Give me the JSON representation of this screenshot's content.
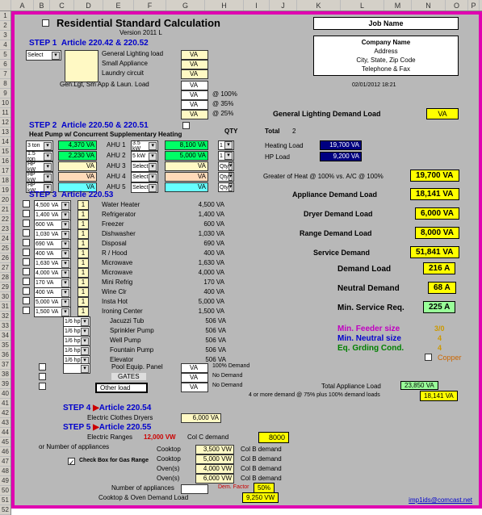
{
  "cols": [
    "A",
    "B",
    "C",
    "D",
    "E",
    "F",
    "G",
    "H",
    "I",
    "J",
    "K",
    "L",
    "M",
    "N",
    "O",
    "P"
  ],
  "title": "Residential Standard Calculation",
  "version": "Version 2011 L",
  "job_name": "Job Name",
  "company": {
    "name": "Company Name",
    "addr": "Address",
    "csz": "City, State, Zip Code",
    "tel": "Telephone & Fax"
  },
  "timestamp": "02/01/2012 18:21",
  "step1": {
    "heading": "STEP 1",
    "article": "Article 220.42 & 220.52",
    "select": "Select",
    "items": [
      "General Lighting load",
      "Small Appliance",
      "Laundry circuit"
    ],
    "sumline": "Gen.Lgt, Sm App & Laun. Load",
    "pct": [
      "@ 100%",
      "@ 35%",
      "@ 25%"
    ]
  },
  "step2": {
    "heading": "STEP 2",
    "article": "Article 220.50 & 220.51",
    "sub": "Heat Pump w/ Concurrent Supplementary Heating",
    "qty": "QTY",
    "rows": [
      {
        "sel": "3 ton",
        "v": "4,370 VA",
        "ahu": "AHU 1",
        "kw": "3.5 kW",
        "big": "8,100 VA",
        "q": "1",
        "cls": "green-box"
      },
      {
        "sel": "1.5 ton",
        "v": "2,230 VA",
        "ahu": "AHU 2",
        "kw": "5 kW",
        "big": "5,000 VA",
        "q": "1",
        "cls": "green-box"
      },
      {
        "sel": "HP kW",
        "v": "VA",
        "ahu": "AHU 3",
        "kw": "Select",
        "big": "VA",
        "q": "Qty",
        "cls": "cream-box"
      },
      {
        "sel": "HP kW",
        "v": "VA",
        "ahu": "AHU 4",
        "kw": "Select",
        "big": "VA",
        "q": "Qty",
        "cls": "peach-box"
      },
      {
        "sel": "HP kW",
        "v": "VA",
        "ahu": "AHU 5",
        "kw": "Select",
        "big": "VA",
        "q": "Qty",
        "cls": "cyan-box"
      }
    ]
  },
  "total_label": "Total",
  "total_n": "2",
  "heating_load_l": "Heating Load",
  "heating_load_v": "19,700 VA",
  "hp_load_l": "HP Load",
  "hp_load_v": "9,200 VA",
  "greater": "Greater of Heat @ 100% vs. A/C @ 100%",
  "greater_v": "19,700 VA",
  "gl_demand_l": "General Lighting Demand Load",
  "gl_demand_v": "VA",
  "step3": {
    "heading": "STEP 3",
    "article": "Article 220.53",
    "appliances": [
      {
        "sel": "4,500 VA",
        "q": "1",
        "n": "Water Heater",
        "v": "4,500 VA"
      },
      {
        "sel": "1,400 VA",
        "q": "1",
        "n": "Refrigerator",
        "v": "1,400 VA"
      },
      {
        "sel": "600 VA",
        "q": "1",
        "n": "Freezer",
        "v": "600 VA"
      },
      {
        "sel": "1,030 VA",
        "q": "1",
        "n": "Dishwasher",
        "v": "1,030 VA"
      },
      {
        "sel": "690 VA",
        "q": "1",
        "n": "Disposal",
        "v": "690 VA"
      },
      {
        "sel": "400 VA",
        "q": "1",
        "n": "R / Hood",
        "v": "400 VA"
      },
      {
        "sel": "1,630 VA",
        "q": "1",
        "n": "Microwave",
        "v": "1,630 VA"
      },
      {
        "sel": "4,000 VA",
        "q": "1",
        "n": "Microwave",
        "v": "4,000 VA"
      },
      {
        "sel": "170 VA",
        "q": "1",
        "n": "Mini Refrig",
        "v": "170 VA"
      },
      {
        "sel": "400 VA",
        "q": "1",
        "n": "Wine Clr",
        "v": "400 VA"
      },
      {
        "sel": "5,000 VA",
        "q": "1",
        "n": "Insta Hot",
        "v": "5,000 VA"
      },
      {
        "sel": "1,500 VA",
        "q": "1",
        "n": "Ironing Center",
        "v": "1,500 VA"
      }
    ],
    "motors": [
      {
        "sel": "1/6 hp",
        "n": "Jacuzzi Tub",
        "v": "506 VA"
      },
      {
        "sel": "1/6 hp",
        "n": "Sprinkler Pump",
        "v": "506 VA"
      },
      {
        "sel": "1/6 hp",
        "n": "Well Pump",
        "v": "506 VA"
      },
      {
        "sel": "1/6 hp",
        "n": "Fountain Pump",
        "v": "506 VA"
      },
      {
        "sel": "1/6 hp",
        "n": "Elevator",
        "v": "506 VA"
      }
    ],
    "pool": "Pool Equip. Panel",
    "pool_note": "100% Demand",
    "gates": "GATES",
    "gates_note": "No Demand",
    "other": "Other load",
    "other_note": "No Demand"
  },
  "appl_demand_l": "Appliance Demand Load",
  "appl_demand_v": "18,141 VA",
  "dryer_demand_l": "Dryer Demand Load",
  "dryer_demand_v": "6,000 VA",
  "range_demand_l": "Range Demand Load",
  "range_demand_v": "8,000 VA",
  "service_demand_l": "Service Demand",
  "service_demand_v": "51,841 VA",
  "demand_load_l": "Demand Load",
  "demand_load_v": "216 A",
  "neutral_demand_l": "Neutral Demand",
  "neutral_demand_v": "68 A",
  "min_service_l": "Min. Service Req.",
  "min_service_v": "225 A",
  "feeder_l": "Min. Feeder size",
  "feeder_v": "3/0",
  "neutral_size_l": "Min. Neutral size",
  "neutral_size_v": "4",
  "grding_l": "Eq. Grding Cond.",
  "grding_v": "4",
  "copper": "Copper",
  "tot_appl_l": "Total Appliance Load",
  "tot_appl_v": "23,850 VA",
  "four_more": "4 or more demand @ 75% plus 100% demand loads",
  "four_more_v": "18,141 VA",
  "step4": {
    "heading": "STEP  4",
    "article": "Article 220.54",
    "item": "Electric Clothes Dryers",
    "v": "6,000 VA"
  },
  "step5": {
    "heading": "STEP  5",
    "article": "Article 220.55",
    "item": "Electric Ranges",
    "v": "12,000 VW",
    "col_c": "Col  C demand",
    "col_c_v": "8000"
  },
  "or_appl": "or   Number of appliances",
  "gas": "Check Box for Gas Range",
  "cook_rows": [
    {
      "n": "Cooktop",
      "v": "3,500 VW",
      "c": "Col B demand"
    },
    {
      "n": "Cooktop",
      "v": "5,000 VW",
      "c": "Col B demand"
    },
    {
      "n": "Oven(s)",
      "v": "4,000 VW",
      "c": "Col B demand"
    },
    {
      "n": "Oven(s)",
      "v": "6,000 VW",
      "c": "Col B demand"
    }
  ],
  "num_appl": "Number of appliances",
  "dem_factor": "Dem. Factor",
  "dem_factor_v": "50%",
  "cook_oven": "Cooktop & Oven Demand Load",
  "cook_oven_v": "9,250 VW",
  "email": "imp1ids@comcast.net"
}
